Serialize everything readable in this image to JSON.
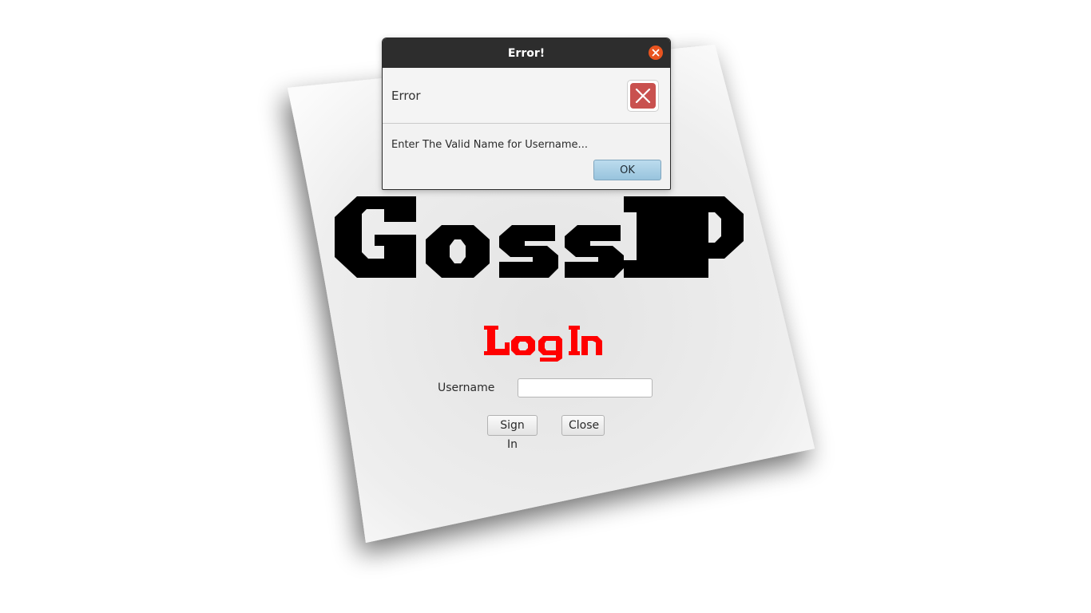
{
  "app": {
    "brand_name": "GossiP",
    "heading": "Log In"
  },
  "login_form": {
    "username_label": "Username",
    "username_value": "",
    "username_placeholder": "",
    "sign_in_label": "Sign In",
    "close_label": "Close"
  },
  "error_dialog": {
    "window_title": "Error!",
    "header_text": "Error",
    "message": "Enter The Valid Name for Username...",
    "ok_label": "OK"
  },
  "colors": {
    "heading_red": "#ff0000",
    "brand_black": "#000000",
    "titlebar_close": "#e9541f",
    "error_icon": "#c9514f",
    "ok_button": "#a8d0e6"
  },
  "icons": {
    "titlebar_close": "close-icon",
    "dialog_icon": "error-x-icon"
  }
}
